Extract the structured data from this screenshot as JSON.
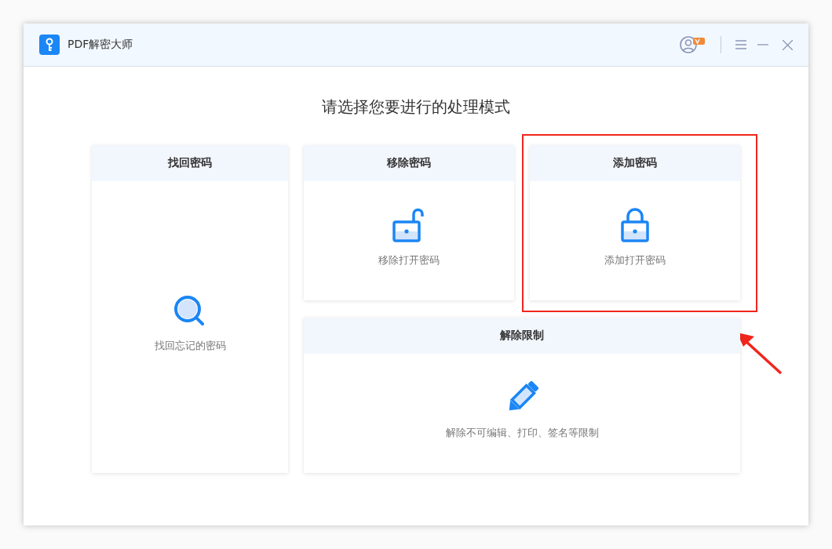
{
  "window": {
    "title": "PDF解密大师"
  },
  "heading": "请选择您要进行的处理模式",
  "cards": [
    {
      "title": "找回密码",
      "kind": "search",
      "description": "找回忘记的密码",
      "highlighted": false
    },
    {
      "title": "移除密码",
      "kind": "unlock",
      "description": "移除打开密码",
      "highlighted": false
    },
    {
      "title": "添加密码",
      "kind": "lock",
      "description": "添加打开密码",
      "highlighted": true
    },
    {
      "title": "解除限制",
      "kind": "pencil",
      "description": "解除不可编辑、打印、签名等限制",
      "highlighted": false
    }
  ]
}
